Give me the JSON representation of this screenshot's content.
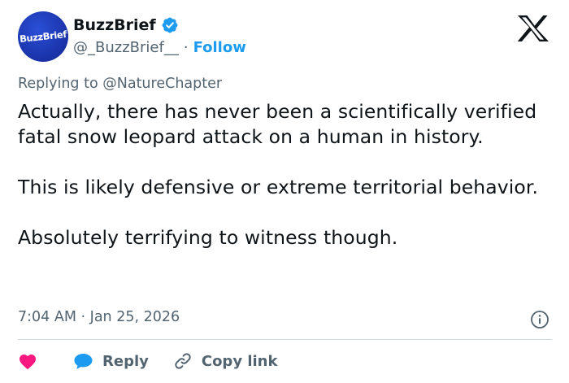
{
  "author": {
    "display_name": "BuzzBrief",
    "handle": "@_BuzzBrief__",
    "follow_label": "Follow",
    "avatar_text": "BuzzBrief"
  },
  "separator": "·",
  "reply_context": {
    "prefix": "Replying to",
    "mention": "@NatureChapter"
  },
  "tweet": {
    "paragraphs": [
      "Actually, there has never been a scientifically verified fatal snow leopard attack on a human in history.",
      "This is likely defensive or extreme territorial behavior.",
      "Absolutely terrifying to witness though."
    ],
    "time": "7:04 AM",
    "date": "Jan 25, 2026"
  },
  "actions": {
    "reply_label": "Reply",
    "copy_link_label": "Copy link"
  },
  "colors": {
    "brand_blue": "#1d9bf0",
    "like_pink": "#f91880",
    "secondary_text": "#536471",
    "avatar_blue": "#1a32a8"
  },
  "icons": [
    "verified-badge-icon",
    "x-logo-icon",
    "info-icon",
    "heart-icon",
    "reply-bubble-icon",
    "link-icon"
  ]
}
